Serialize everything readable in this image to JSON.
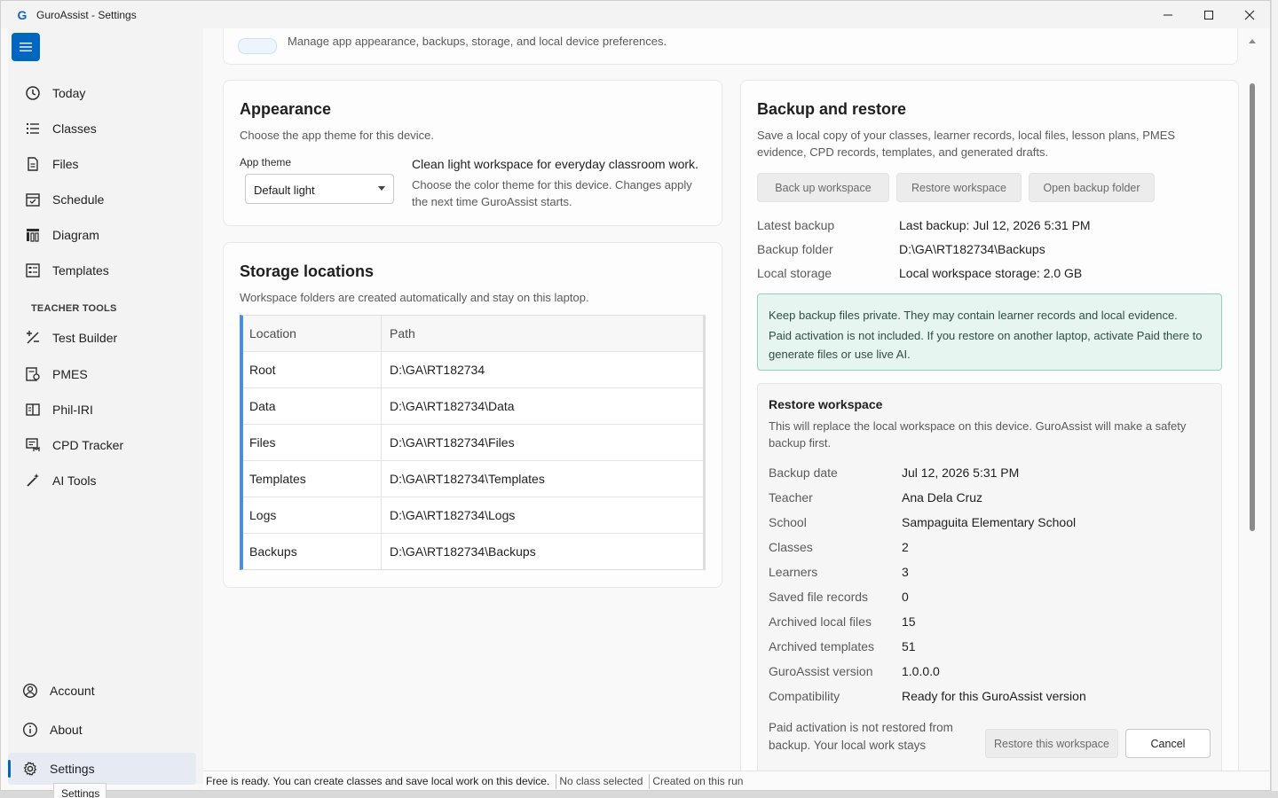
{
  "window": {
    "title": "GuroAssist - Settings",
    "logo_text": "G"
  },
  "sidebar": {
    "items": [
      {
        "label": "Today",
        "icon": "clock-icon"
      },
      {
        "label": "Classes",
        "icon": "list-icon"
      },
      {
        "label": "Files",
        "icon": "file-icon"
      },
      {
        "label": "Schedule",
        "icon": "calendar-icon"
      },
      {
        "label": "Diagram",
        "icon": "diagram-icon"
      },
      {
        "label": "Templates",
        "icon": "template-icon"
      }
    ],
    "section_label": "TEACHER TOOLS",
    "tools": [
      {
        "label": "Test Builder",
        "icon": "test-builder-icon"
      },
      {
        "label": "PMES",
        "icon": "pmes-icon"
      },
      {
        "label": "Phil-IRI",
        "icon": "book-icon"
      },
      {
        "label": "CPD Tracker",
        "icon": "tracker-icon"
      },
      {
        "label": "AI Tools",
        "icon": "magic-wand-icon"
      }
    ],
    "bottom": [
      {
        "label": "Account",
        "icon": "account-icon"
      },
      {
        "label": "About",
        "icon": "info-icon"
      },
      {
        "label": "Settings",
        "icon": "gear-icon",
        "active": true
      }
    ],
    "tooltip": "Settings"
  },
  "header": {
    "subtitle": "Manage app appearance, backups, storage, and local device preferences."
  },
  "appearance": {
    "title": "Appearance",
    "subtitle": "Choose the app theme for this device.",
    "field_label": "App theme",
    "selected": "Default light",
    "description": "Clean light workspace for everyday classroom work.",
    "note": "Choose the color theme for this device. Changes apply the next time GuroAssist starts."
  },
  "storage": {
    "title": "Storage locations",
    "subtitle": "Workspace folders are created automatically and stay on this laptop.",
    "headers": [
      "Location",
      "Path"
    ],
    "rows": [
      [
        "Root",
        "D:\\GA\\RT182734"
      ],
      [
        "Data",
        "D:\\GA\\RT182734\\Data"
      ],
      [
        "Files",
        "D:\\GA\\RT182734\\Files"
      ],
      [
        "Templates",
        "D:\\GA\\RT182734\\Templates"
      ],
      [
        "Logs",
        "D:\\GA\\RT182734\\Logs"
      ],
      [
        "Backups",
        "D:\\GA\\RT182734\\Backups"
      ]
    ]
  },
  "backup": {
    "title": "Backup and restore",
    "subtitle": "Save a local copy of your classes, learner records, local files, lesson plans, PMES evidence, CPD records, templates, and generated drafts.",
    "buttons": [
      "Back up workspace",
      "Restore workspace",
      "Open backup folder"
    ],
    "info": [
      {
        "k": "Latest backup",
        "v": "Last backup: Jul 12, 2026 5:31 PM"
      },
      {
        "k": "Backup folder",
        "v": "D:\\GA\\RT182734\\Backups"
      },
      {
        "k": "Local storage",
        "v": "Local workspace storage: 2.0 GB"
      }
    ],
    "notice_1": "Keep backup files private. They may contain learner records and local evidence.",
    "notice_2": "Paid activation is not included. If you restore on another laptop, activate Paid there to generate files or use live AI."
  },
  "restore": {
    "title": "Restore workspace",
    "subtitle": "This will replace the local workspace on this device. GuroAssist will make a safety backup first.",
    "details": [
      {
        "k": "Backup date",
        "v": "Jul 12, 2026 5:31 PM"
      },
      {
        "k": "Teacher",
        "v": "Ana Dela Cruz"
      },
      {
        "k": "School",
        "v": "Sampaguita Elementary School"
      },
      {
        "k": "Classes",
        "v": "2"
      },
      {
        "k": "Learners",
        "v": "3"
      },
      {
        "k": "Saved file records",
        "v": "0"
      },
      {
        "k": "Archived local files",
        "v": "15"
      },
      {
        "k": "Archived templates",
        "v": "51"
      },
      {
        "k": "GuroAssist version",
        "v": "1.0.0.0"
      },
      {
        "k": "Compatibility",
        "v": "Ready for this GuroAssist version"
      }
    ],
    "footnote": "Paid activation is not restored from backup. Your local work stays available.",
    "restore_label": "Restore this workspace",
    "cancel_label": "Cancel"
  },
  "status": {
    "message": "Free is ready. You can create classes and save local work on this device.",
    "class": "No class selected",
    "run": "Created on this run"
  },
  "colors": {
    "accent": "#0067c0",
    "notice_bg": "#e6f5ef",
    "notice_border": "#8fd3b6"
  }
}
